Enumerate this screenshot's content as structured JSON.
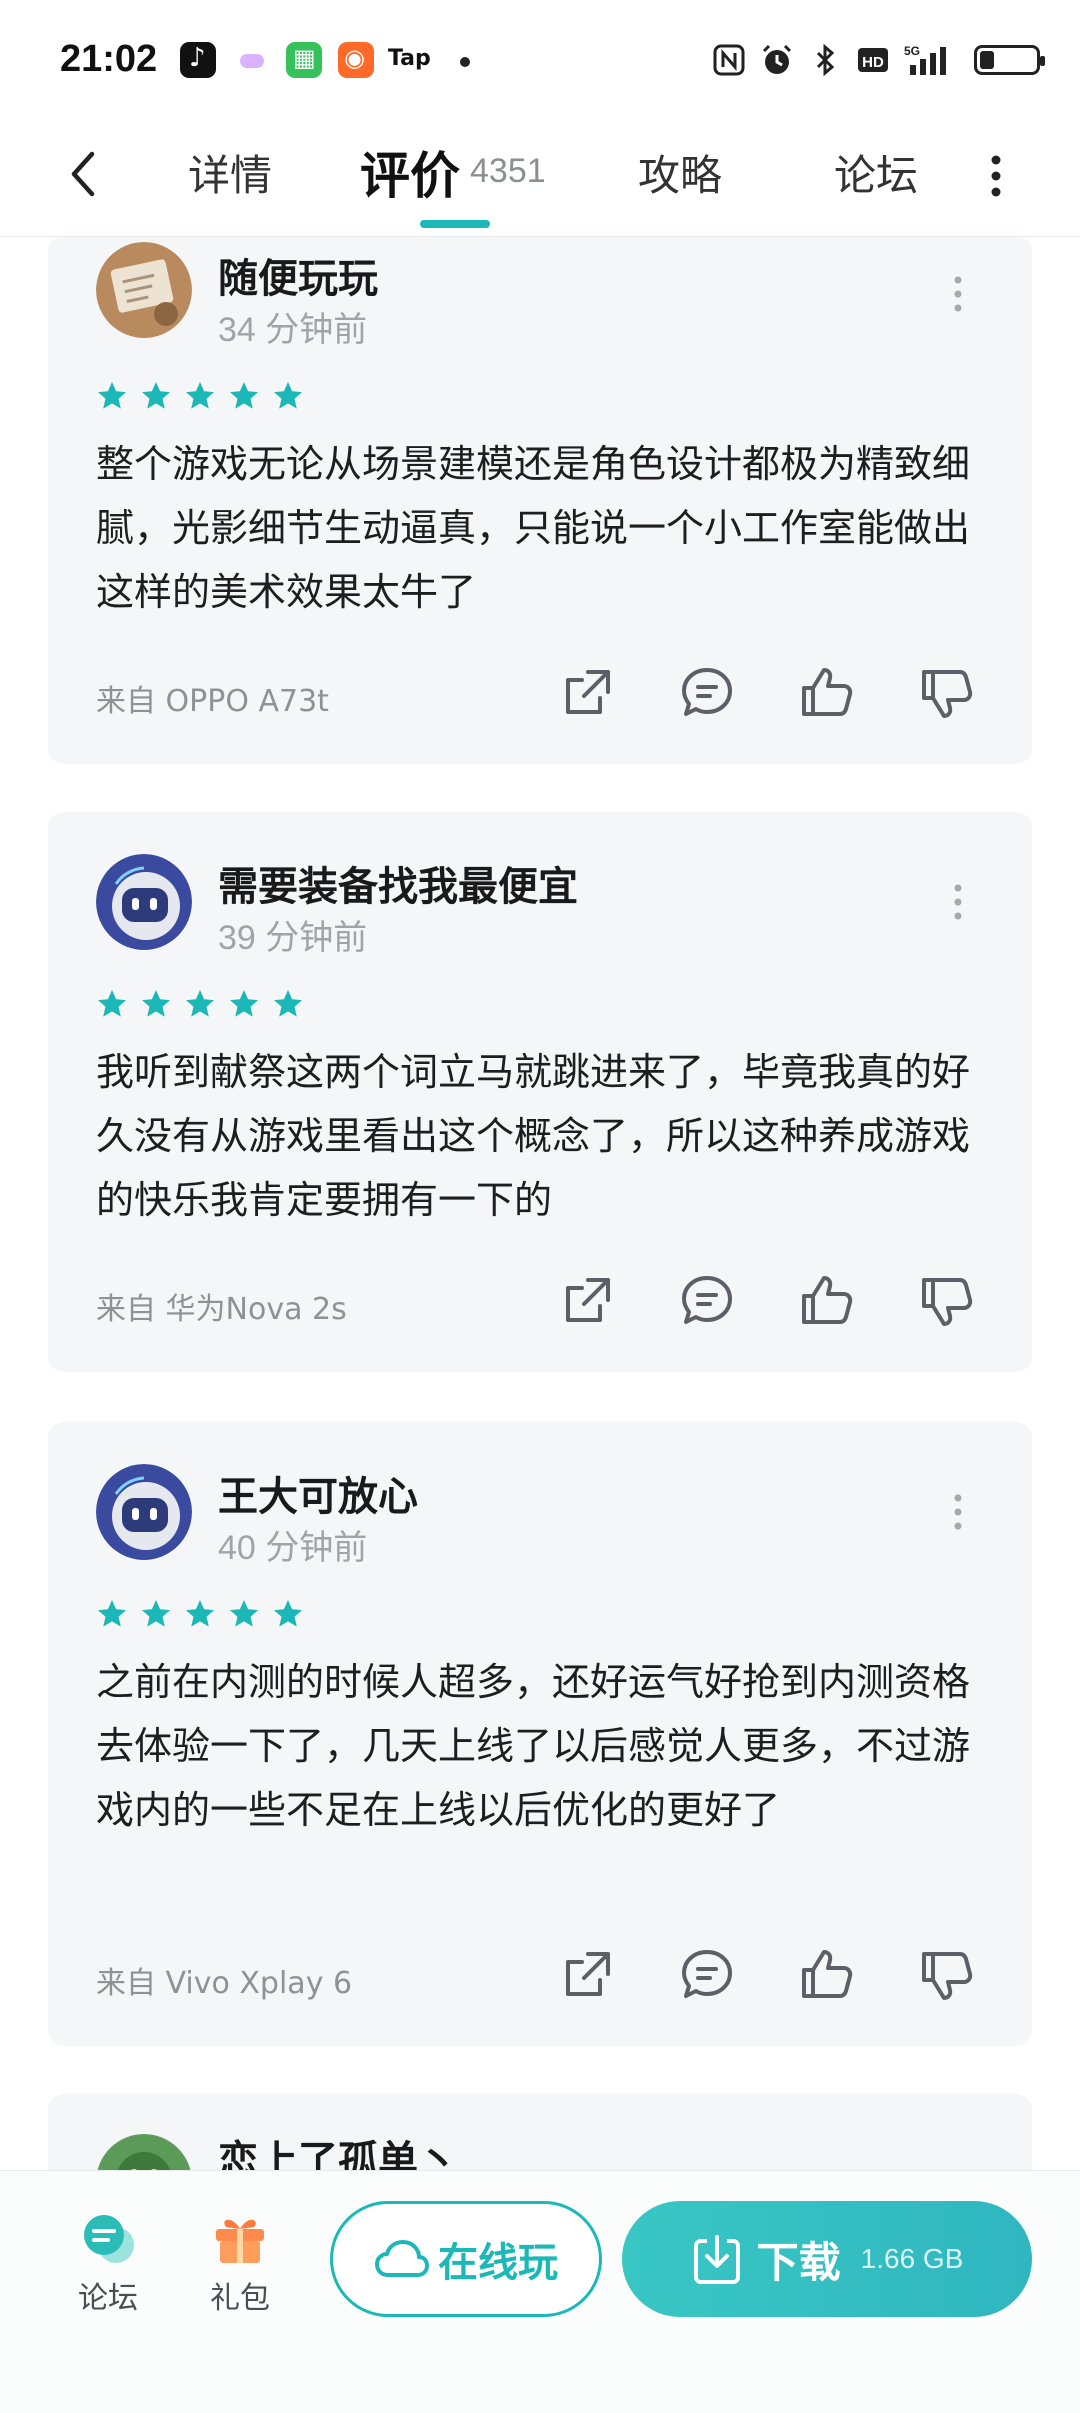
{
  "status_bar": {
    "time": "21:02",
    "tap_label": "Tap",
    "network_label": "5G",
    "hd_label": "HD"
  },
  "nav": {
    "tabs": [
      {
        "label": "详情"
      },
      {
        "label": "评价",
        "count": "4351"
      },
      {
        "label": "攻略"
      },
      {
        "label": "论坛"
      }
    ],
    "active_tab": "评价"
  },
  "reviews": [
    {
      "user": "随便玩玩",
      "time": "34 分钟前",
      "rating": 5,
      "text": "整个游戏无论从场景建模还是角色设计都极为精致细腻，光影细节生动逼真，只能说一个小工作室能做出这样的美术效果太牛了",
      "device": "来自 OPPO A73t"
    },
    {
      "user": "需要装备找我最便宜",
      "time": "39 分钟前",
      "rating": 5,
      "text": "我听到献祭这两个词立马就跳进来了，毕竟我真的好久没有从游戏里看出这个概念了，所以这种养成游戏的快乐我肯定要拥有一下的",
      "device": "来自 华为Nova 2s"
    },
    {
      "user": "王大可放心",
      "time": "40 分钟前",
      "rating": 5,
      "text": "之前在内测的时候人超多，还好运气好抢到内测资格去体验一下了，几天上线了以后感觉人更多，不过游戏内的一些不足在上线以后优化的更好了",
      "device": "来自 Vivo Xplay 6"
    },
    {
      "user": "恋上了孤单丶"
    }
  ],
  "bottom_bar": {
    "forum_label": "论坛",
    "gift_label": "礼包",
    "online_label": "在线玩",
    "download_label": "下载",
    "download_size": "1.66 GB"
  },
  "colors": {
    "accent": "#1cb8b8",
    "card_bg": "#f5f6f8",
    "star": "#1cb8b8"
  }
}
